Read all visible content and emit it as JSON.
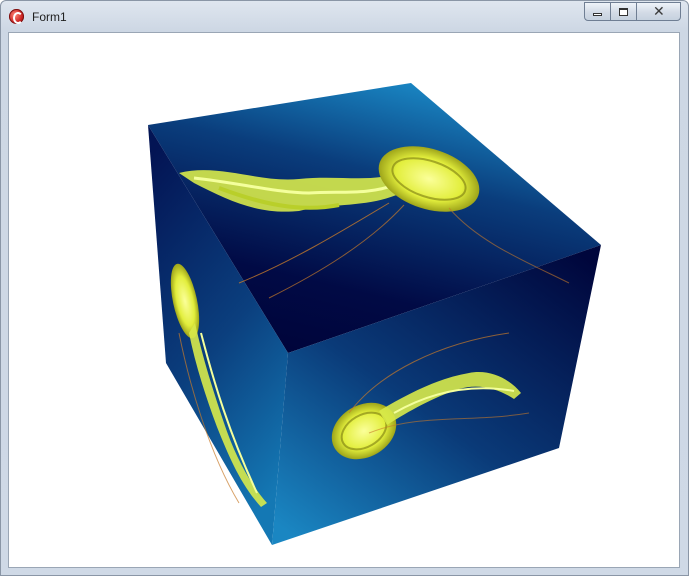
{
  "window": {
    "title": "Form1",
    "icon": "app-icon",
    "buttons": {
      "minimize": "minimize-icon",
      "maximize": "maximize-icon",
      "close": "close-icon"
    }
  },
  "scene": {
    "object": "textured-cube",
    "texture": "jellyfish",
    "colors": {
      "deep": "#00063a",
      "mid": "#0a3b78",
      "edge": "#1a8fc9",
      "jelly": "#e6f25a"
    }
  }
}
